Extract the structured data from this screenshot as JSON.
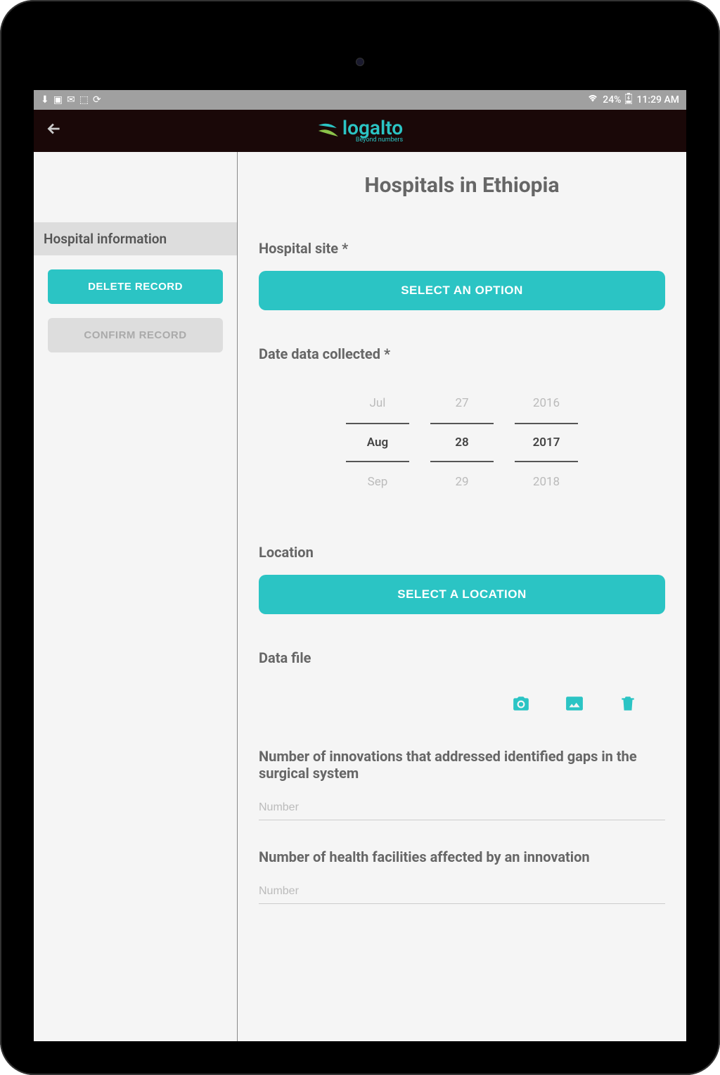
{
  "status": {
    "battery": "24%",
    "time": "11:29 AM"
  },
  "header": {
    "brand": "logalto",
    "tagline": "Beyond numbers"
  },
  "sidebar": {
    "section_label": "Hospital information",
    "delete_label": "DELETE RECORD",
    "confirm_label": "CONFIRM RECORD"
  },
  "main": {
    "title": "Hospitals in Ethiopia",
    "hospital_site": {
      "label": "Hospital site  *",
      "button": "SELECT AN OPTION"
    },
    "date_collected": {
      "label": "Date data collected  *",
      "months": {
        "prev": "Jul",
        "current": "Aug",
        "next": "Sep"
      },
      "days": {
        "prev": "27",
        "current": "28",
        "next": "29"
      },
      "years": {
        "prev": "2016",
        "current": "2017",
        "next": "2018"
      }
    },
    "location": {
      "label": "Location",
      "button": "SELECT A LOCATION"
    },
    "data_file": {
      "label": "Data file"
    },
    "innovations_gaps": {
      "label": "Number of innovations that addressed identified gaps in the surgical system",
      "placeholder": "Number"
    },
    "facilities_affected": {
      "label": "Number of health facilities affected by an innovation",
      "placeholder": "Number"
    }
  }
}
